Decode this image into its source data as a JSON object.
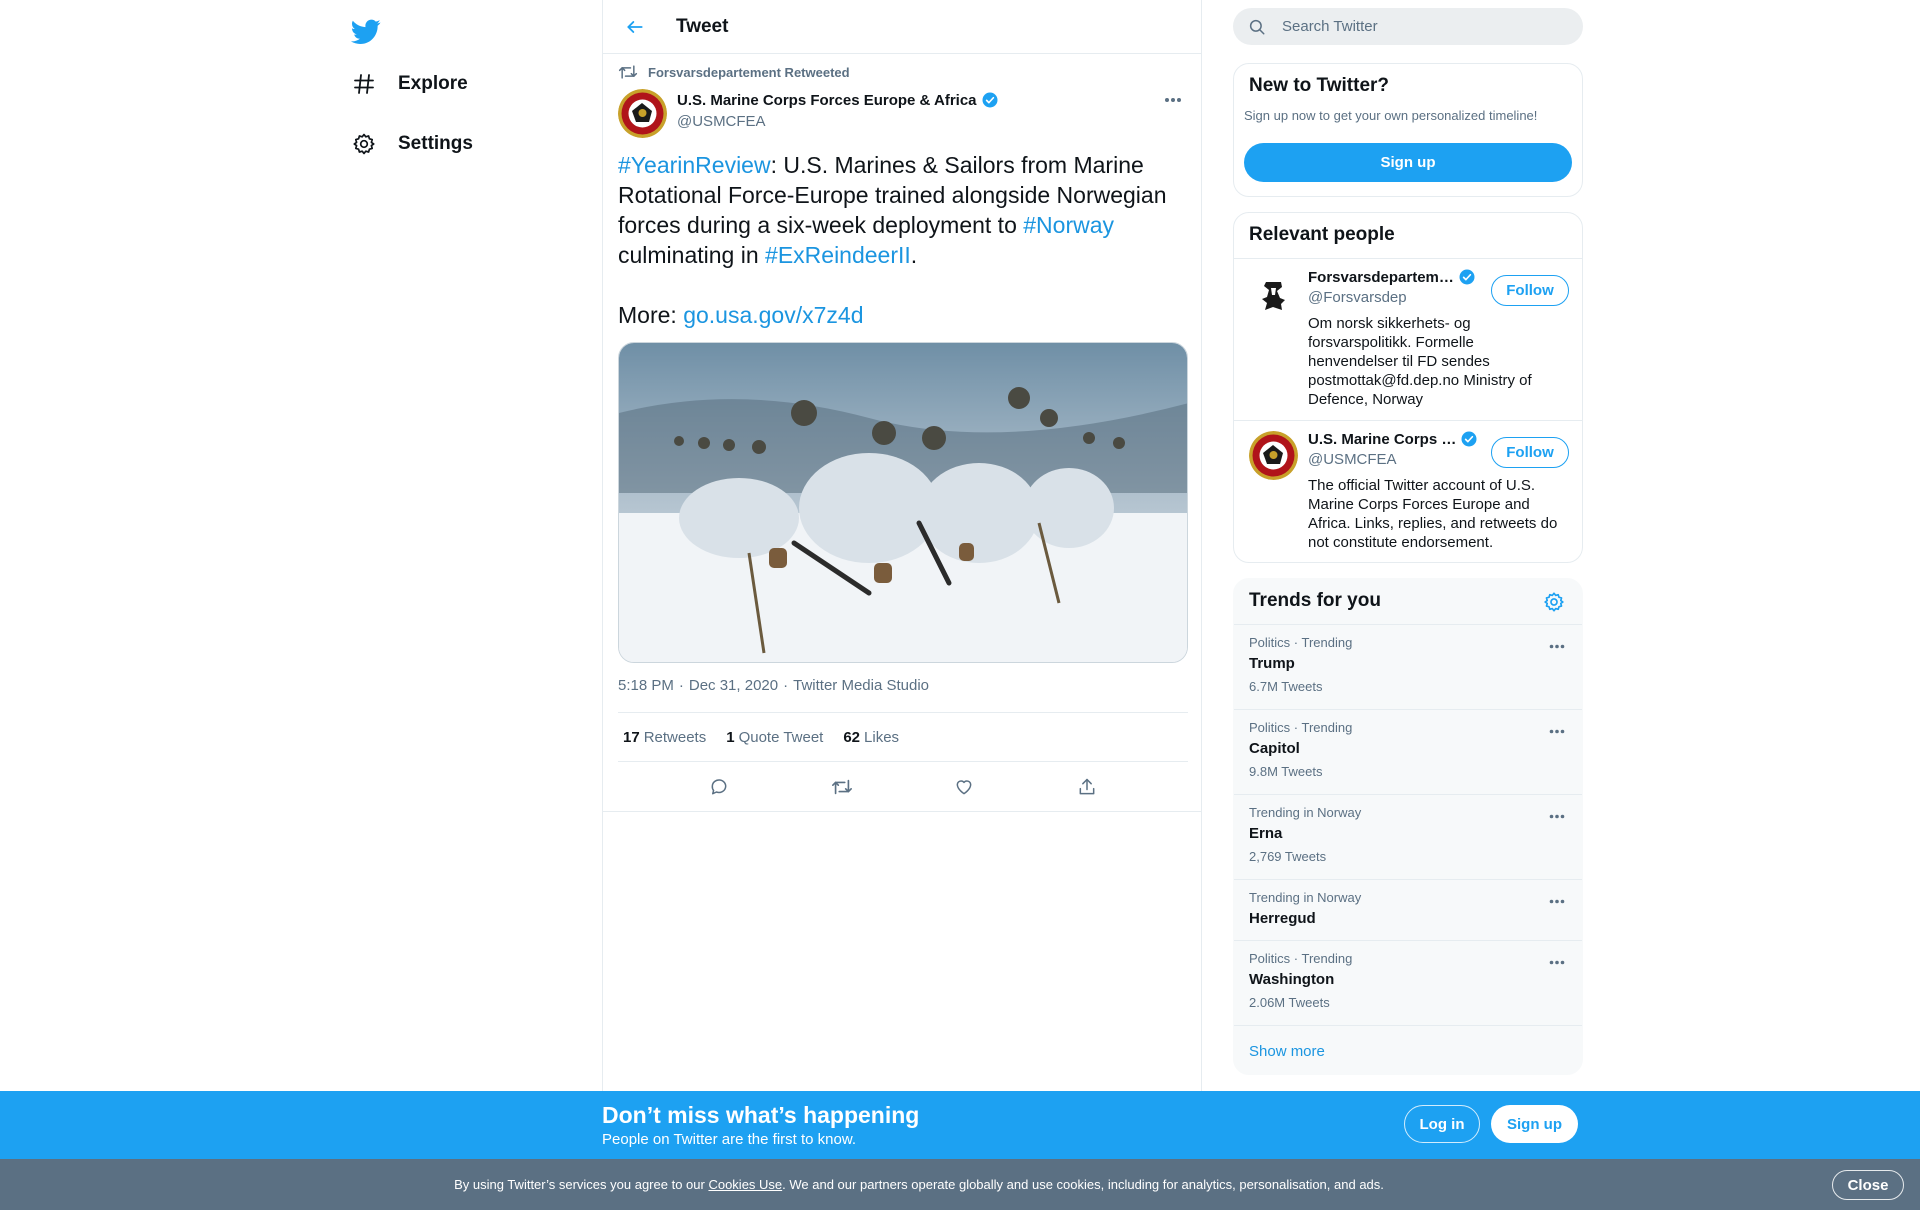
{
  "nav": {
    "logo_icon": "twitter-bird-icon",
    "items": [
      {
        "label": "Explore",
        "icon": "hashtag-icon"
      },
      {
        "label": "Settings",
        "icon": "gear-icon"
      }
    ]
  },
  "header": {
    "title": "Tweet",
    "back_icon": "arrow-left-icon"
  },
  "tweet": {
    "retweeted_by": "Forsvarsdepartement Retweeted",
    "author_name": "U.S. Marine Corps Forces Europe & Africa",
    "author_handle": "@USMCFEA",
    "text": {
      "hashtag1": "#YearinReview",
      "part1": ": U.S. Marines & Sailors from Marine Rotational Force-Europe trained alongside Norwegian forces during a six-week deployment to ",
      "hashtag2": "#Norway",
      "part2": " culminating in ",
      "hashtag3": "#ExReindeerII",
      "part3": ".",
      "more_label": "More: ",
      "link": "go.usa.gov/x7z4d"
    },
    "time": "5:18 PM",
    "date": "Dec 31, 2020",
    "source": "Twitter Media Studio",
    "sep": "·",
    "stats": {
      "retweets_count": "17",
      "retweets_label": "Retweets",
      "quote_count": "1",
      "quote_label": "Quote Tweet",
      "likes_count": "62",
      "likes_label": "Likes"
    }
  },
  "search": {
    "placeholder": "Search Twitter"
  },
  "new_to_twitter": {
    "title": "New to Twitter?",
    "subtitle": "Sign up now to get your own personalized timeline!",
    "button": "Sign up"
  },
  "relevant_people": {
    "title": "Relevant people",
    "people": [
      {
        "name": "Forsvarsdepartem…",
        "handle": "@Forsvarsdep",
        "bio": "Om norsk sikkerhets- og forsvarspolitikk. Formelle henvendelser til FD sendes postmottak@fd.dep.no Ministry of Defence, Norway",
        "follow": "Follow"
      },
      {
        "name": "U.S. Marine Corps …",
        "handle": "@USMCFEA",
        "bio": "The official Twitter account of U.S. Marine Corps Forces Europe and Africa. Links, replies, and retweets do not constitute endorsement.",
        "follow": "Follow"
      }
    ]
  },
  "trends": {
    "title": "Trends for you",
    "items": [
      {
        "context": "Politics · Trending",
        "name": "Trump",
        "count": "6.7M Tweets"
      },
      {
        "context": "Politics · Trending",
        "name": "Capitol",
        "count": "9.8M Tweets"
      },
      {
        "context": "Trending in Norway",
        "name": "Erna",
        "count": "2,769 Tweets"
      },
      {
        "context": "Trending in Norway",
        "name": "Herregud",
        "count": ""
      },
      {
        "context": "Politics · Trending",
        "name": "Washington",
        "count": "2.06M Tweets"
      }
    ],
    "show_more": "Show more"
  },
  "banner": {
    "title": "Don’t miss what’s happening",
    "subtitle": "People on Twitter are the first to know.",
    "login": "Log in",
    "signup": "Sign up"
  },
  "cookie": {
    "prefix": "By using Twitter’s services you agree to our ",
    "link": "Cookies Use",
    "suffix": ". We and our partners operate globally and use cookies, including for analytics, personalisation, and ads.",
    "close": "Close"
  },
  "colors": {
    "accent": "#1da1f2",
    "link": "#1b95e0",
    "secondary_text": "#5b7083",
    "cookie_bar": "#5b7083"
  }
}
